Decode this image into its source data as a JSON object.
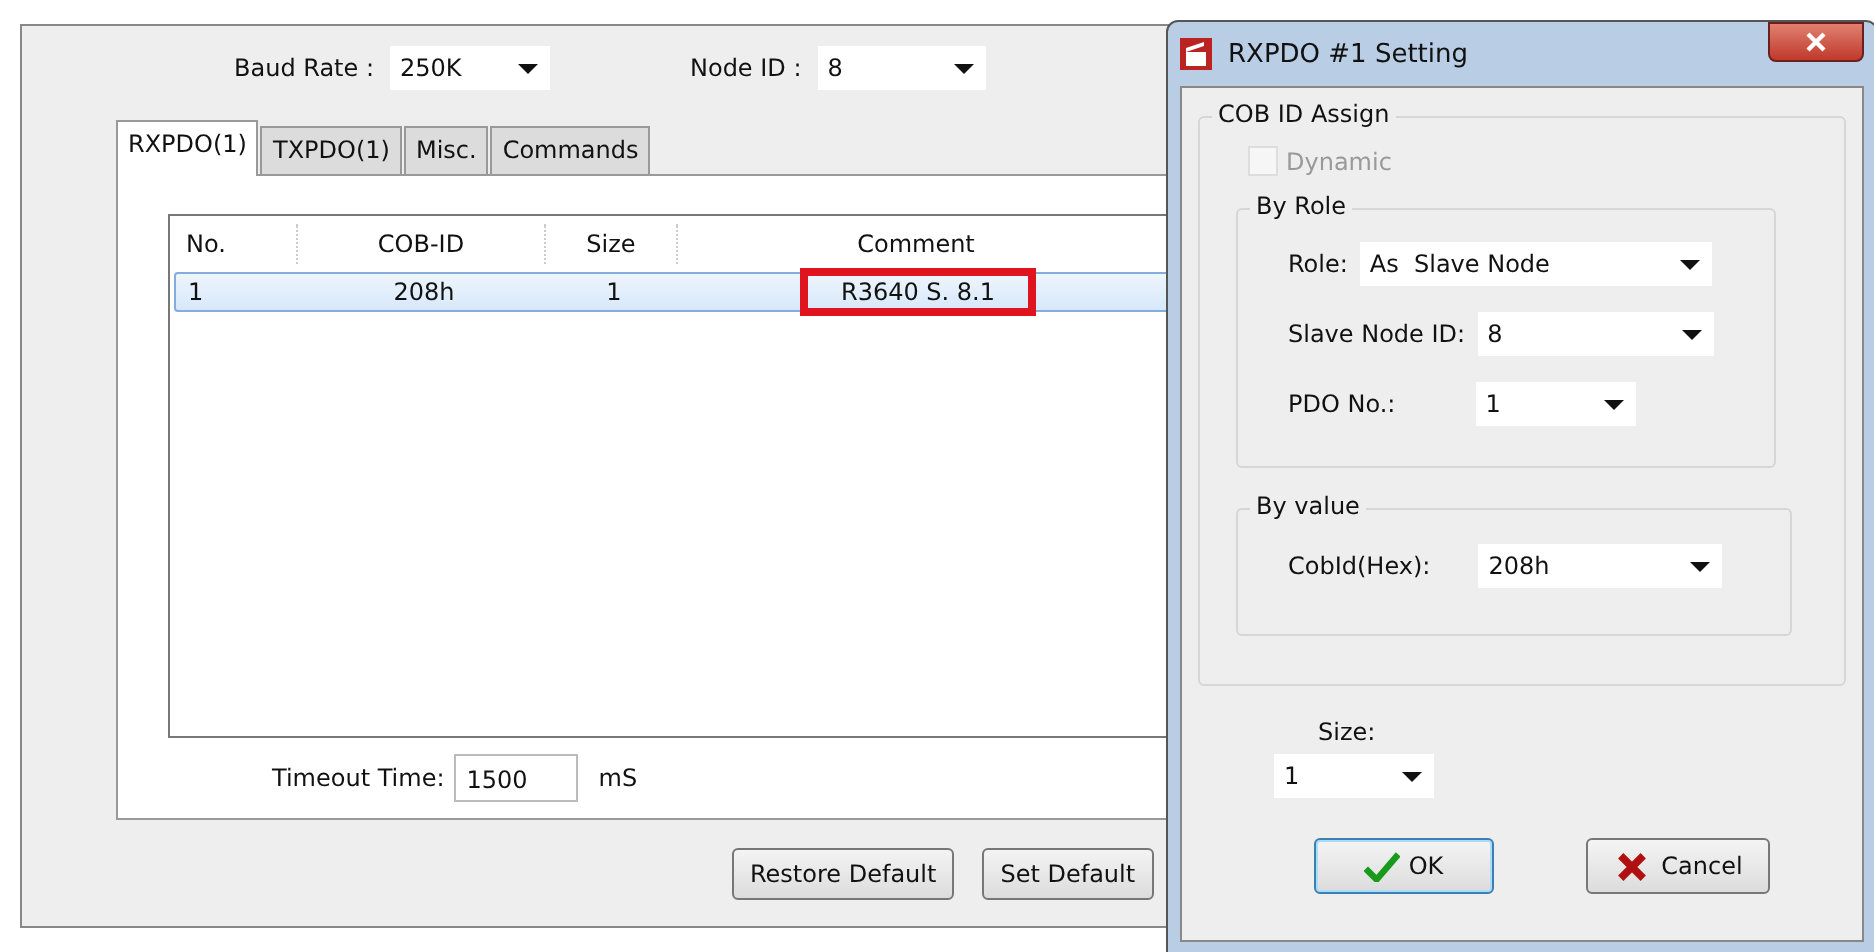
{
  "main": {
    "baud_rate": {
      "label": "Baud Rate :",
      "value": "250K"
    },
    "node_id": {
      "label": "Node ID :",
      "value": "8"
    },
    "tabs": [
      {
        "label": "RXPDO(1)",
        "selected": true
      },
      {
        "label": "TXPDO(1)",
        "selected": false
      },
      {
        "label": "Misc.",
        "selected": false
      },
      {
        "label": "Commands",
        "selected": false
      }
    ],
    "table": {
      "columns": [
        "No.",
        "COB-ID",
        "Size",
        "Comment"
      ],
      "rows": [
        {
          "cells": [
            "1",
            "208h",
            "1",
            "R3640 S. 8.1"
          ],
          "selected": true,
          "comment_highlighted": true
        }
      ]
    },
    "timeout": {
      "label": "Timeout Time:",
      "value": "1500",
      "unit": "mS"
    },
    "buttons": [
      "Restore Default",
      "Set Default"
    ]
  },
  "dialog": {
    "title": "RXPDO #1 Setting",
    "cob_group": "COB ID Assign",
    "dynamic": {
      "label": "Dynamic",
      "checked": false,
      "disabled": true
    },
    "by_role": {
      "title": "By Role",
      "role": {
        "label": "Role:",
        "value": "As  Slave Node"
      },
      "slave_node_id": {
        "label": "Slave Node ID:",
        "value": "8"
      },
      "pdo_no": {
        "label": "PDO No.:",
        "value": "1"
      }
    },
    "by_value": {
      "title": "By value",
      "cob_id": {
        "label": "CobId(Hex):",
        "value": "208h"
      }
    },
    "size": {
      "label": "Size:",
      "value": "1"
    },
    "ok": "OK",
    "cancel": "Cancel"
  }
}
